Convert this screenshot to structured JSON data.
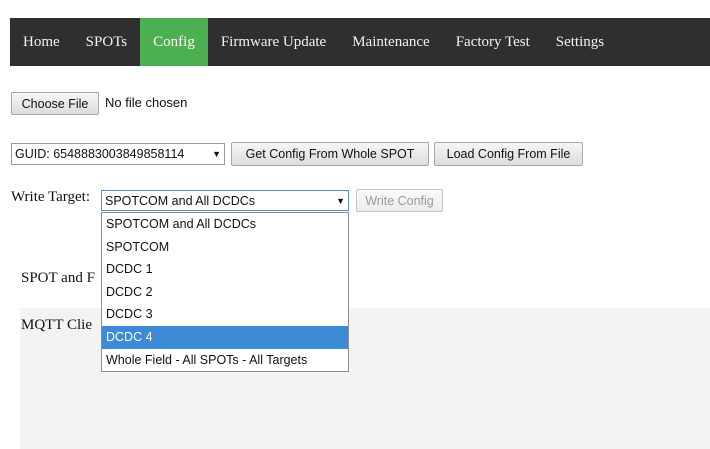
{
  "nav": {
    "items": [
      "Home",
      "SPOTs",
      "Config",
      "Firmware Update",
      "Maintenance",
      "Factory Test",
      "Settings"
    ],
    "active": "Config",
    "active_color": "#4caf50",
    "bar_color": "#2f2f2f"
  },
  "file": {
    "choose_label": "Choose File",
    "status": "No file chosen"
  },
  "config": {
    "guid_value": "GUID: 6548883003849858114",
    "get_config_label": "Get Config From Whole SPOT",
    "load_config_label": "Load Config From File"
  },
  "write": {
    "label": "Write Target:",
    "selected": "SPOTCOM and All DCDCs",
    "button_label": "Write Config",
    "options": [
      "SPOTCOM and All DCDCs",
      "SPOTCOM",
      "DCDC 1",
      "DCDC 2",
      "DCDC 3",
      "DCDC 4",
      "Whole Field - All SPOTs - All Targets"
    ],
    "highlighted_option": "DCDC 4",
    "highlight_color": "#3d8ad6"
  },
  "sections": {
    "spot_label_visible": "SPOT and F",
    "mqtt_label_visible": "MQTT Clie"
  }
}
